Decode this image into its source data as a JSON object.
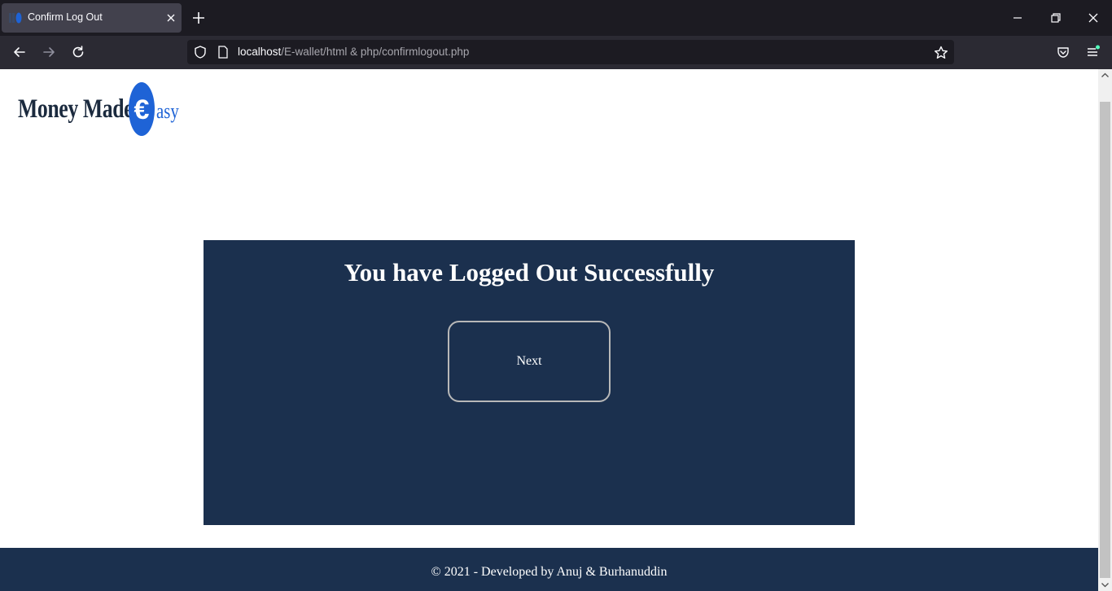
{
  "browser": {
    "tab_title": "Confirm Log Out",
    "url_host": "localhost",
    "url_path": "/E-wallet/html & php/confirmlogout.php"
  },
  "logo": {
    "text_main": "Money Made",
    "text_coin": "€",
    "text_tail": "asy"
  },
  "main": {
    "title": "You have Logged Out Successfully",
    "next_label": "Next"
  },
  "footer": {
    "text": "© 2021 - Developed by Anuj & Burhanuddin"
  },
  "colors": {
    "brand_navy": "#1b304e",
    "coin_blue": "#1e63d6",
    "tab_bg": "#42414d",
    "toolbar_bg": "#2b2a33"
  },
  "icons": [
    "close-icon",
    "plus-icon",
    "minimize-icon",
    "restore-icon",
    "back-icon",
    "forward-icon",
    "reload-icon",
    "shield-icon",
    "page-icon",
    "star-icon",
    "pocket-icon",
    "menu-icon"
  ]
}
